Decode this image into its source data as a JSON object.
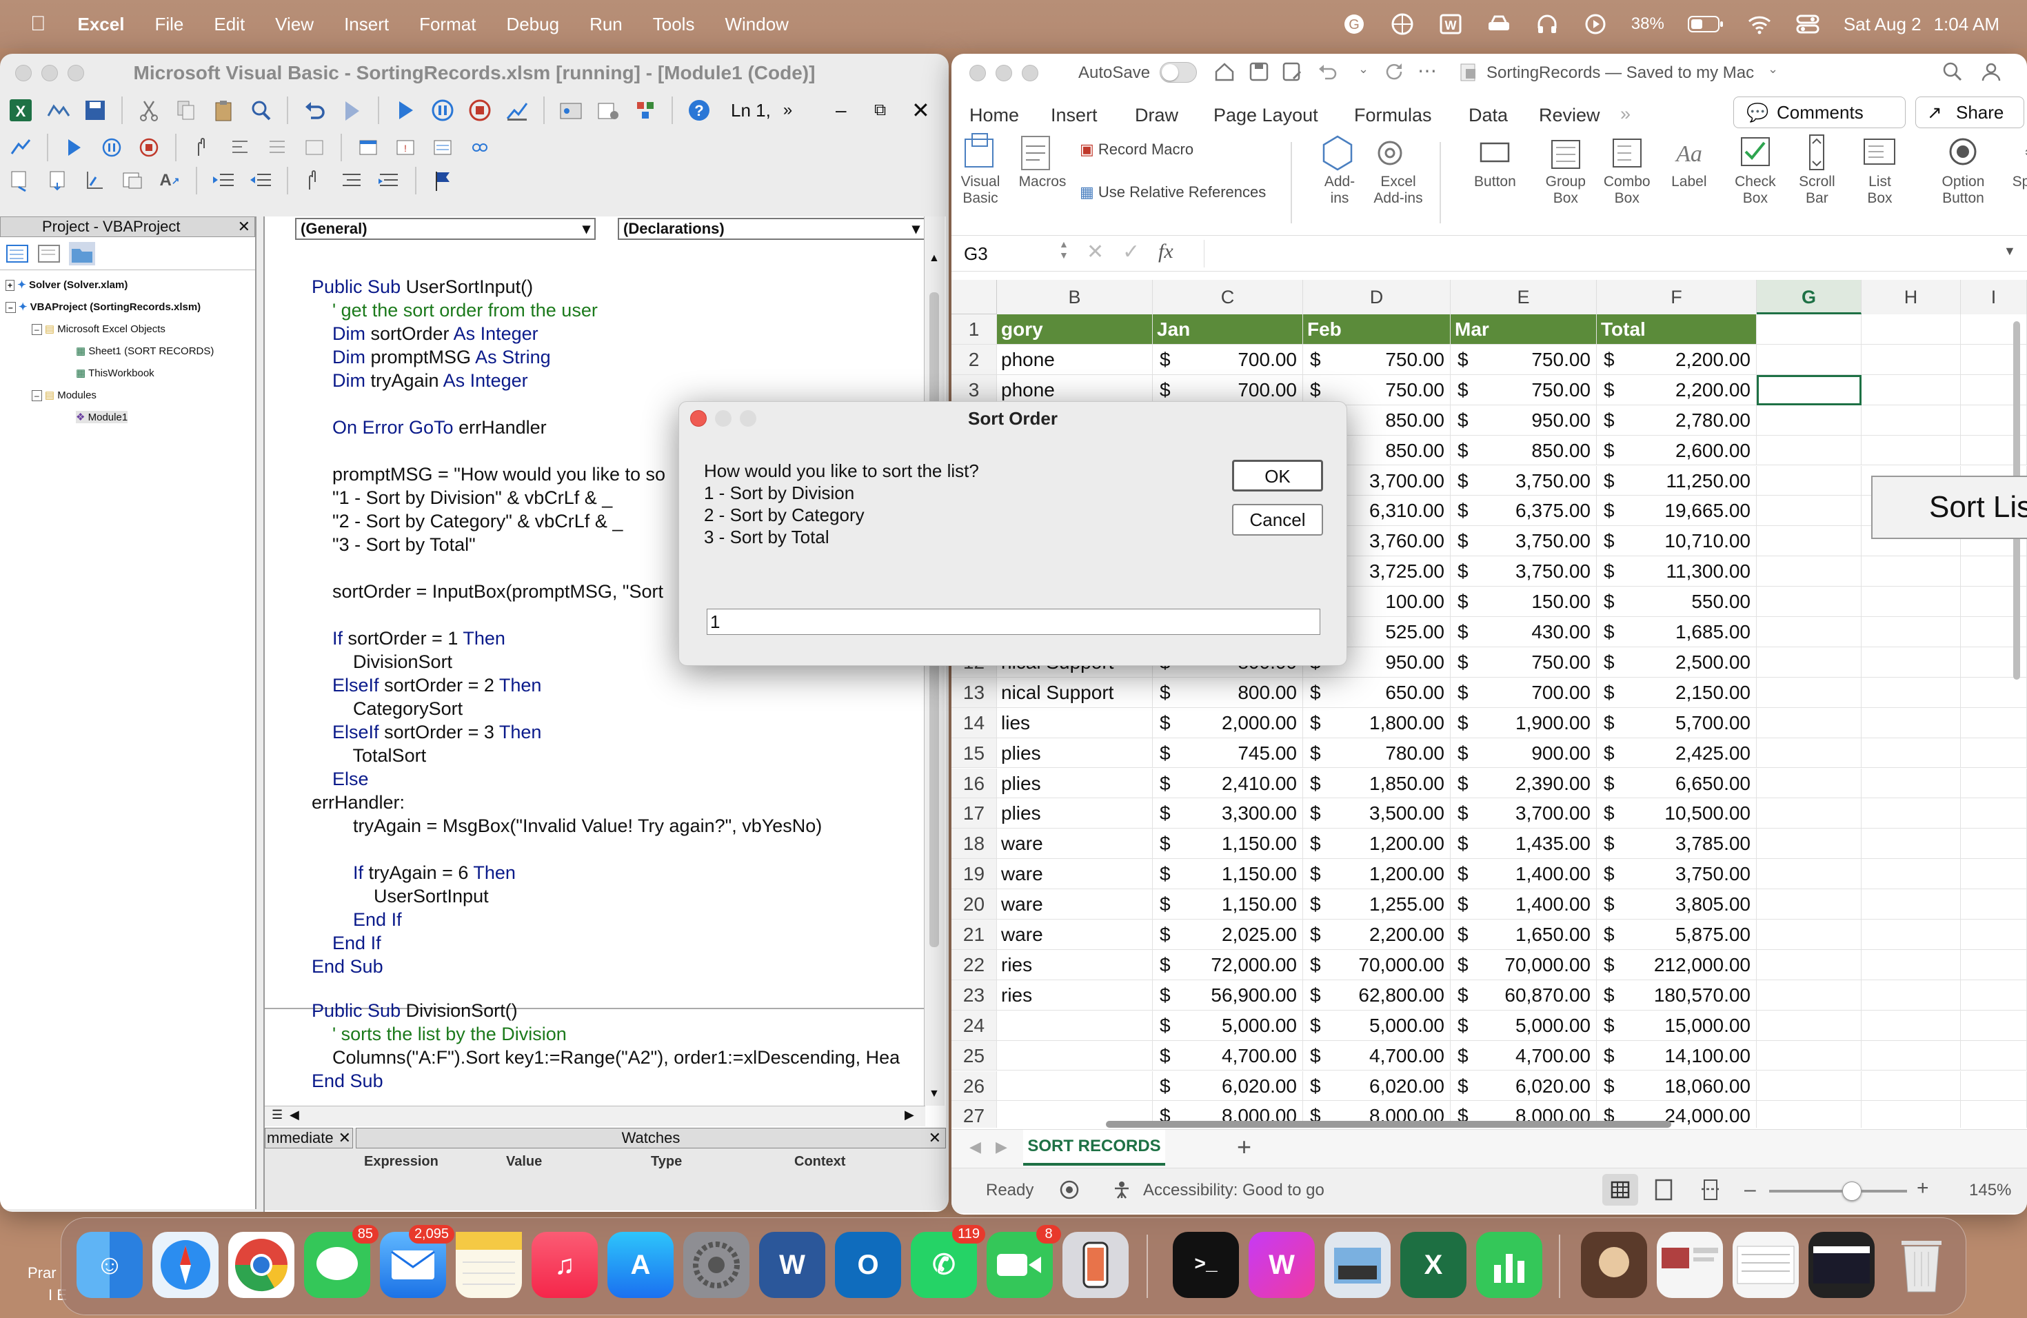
{
  "menubar": {
    "app": "Excel",
    "items": [
      "File",
      "Edit",
      "View",
      "Insert",
      "Format",
      "Debug",
      "Run",
      "Tools",
      "Window"
    ],
    "battery": "38%",
    "date": "Sat Aug 2",
    "time": "1:04 AM"
  },
  "vbe": {
    "title": "Microsoft Visual Basic - SortingRecords.xlsm [running] - [Module1 (Code)]",
    "position": "Ln 1,",
    "project_title": "Project - VBAProject",
    "tree": [
      "Solver (Solver.xlam)",
      "VBAProject (SortingRecords.xlsm)",
      "Microsoft Excel Objects",
      "Sheet1 (SORT RECORDS)",
      "ThisWorkbook",
      "Modules",
      "Module1"
    ],
    "combo_left": "(General)",
    "combo_right": "(Declarations)",
    "immediate": "mmediate",
    "watches": "Watches",
    "watch_cols": [
      "Expression",
      "Value",
      "Type",
      "Context"
    ],
    "code1": [
      "Public Sub UserSortInput()",
      "    ' get the sort order from the user",
      "    Dim sortOrder As Integer",
      "    Dim promptMSG As String",
      "    Dim tryAgain As Integer",
      "",
      "    On Error GoTo errHandler",
      "",
      "    promptMSG = \"How would you like to so",
      "    \"1 - Sort by Division\" & vbCrLf & _",
      "    \"2 - Sort by Category\" & vbCrLf & _",
      "    \"3 - Sort by Total\"",
      "",
      "    sortOrder = InputBox(promptMSG, \"Sort",
      "",
      "    If sortOrder = 1 Then",
      "        DivisionSort",
      "    ElseIf sortOrder = 2 Then",
      "        CategorySort",
      "    ElseIf sortOrder = 3 Then",
      "        TotalSort",
      "    Else",
      "errHandler:",
      "        tryAgain = MsgBox(\"Invalid Value! Try again?\", vbYesNo)",
      "",
      "        If tryAgain = 6 Then",
      "            UserSortInput",
      "        End If",
      "    End If",
      "End Sub"
    ],
    "code2": [
      "Public Sub DivisionSort()",
      "    ' sorts the list by the Division",
      "    Columns(\"A:F\").Sort key1:=Range(\"A2\"), order1:=xlDescending, Hea",
      "End Sub"
    ]
  },
  "dialog": {
    "title": "Sort Order",
    "lines": [
      "How would you like to sort the list?",
      "1 - Sort by Division",
      "2 - Sort by Category",
      "3 - Sort by Total"
    ],
    "ok": "OK",
    "cancel": "Cancel",
    "input_value": "1"
  },
  "excel": {
    "autosave": "AutoSave",
    "doc_title": "SortingRecords — Saved to my Mac",
    "tabs": [
      "Home",
      "Insert",
      "Draw",
      "Page Layout",
      "Formulas",
      "Data",
      "Review"
    ],
    "comments": "Comments",
    "share": "Share",
    "ribbon": {
      "visual_basic": "Visual Basic",
      "macros": "Macros",
      "record_macro": "Record Macro",
      "relative_refs": "Use Relative References",
      "addins": "Add-ins",
      "excel_addins": "Excel Add-ins",
      "controls": [
        "Button",
        "Group Box",
        "Combo Box",
        "Label",
        "Check Box",
        "Scroll Bar",
        "List Box",
        "Option Button",
        "Spinner"
      ]
    },
    "name_box": "G3",
    "columns": [
      "B",
      "C",
      "D",
      "E",
      "F",
      "G",
      "H",
      "I"
    ],
    "header_row": [
      "gory",
      "Jan",
      "Feb",
      "Mar",
      "Total"
    ],
    "rows": [
      {
        "n": "2",
        "b": "phone",
        "c": "700.00",
        "d": "750.00",
        "e": "750.00",
        "f": "2,200.00"
      },
      {
        "n": "3",
        "b": "phone",
        "c": "700.00",
        "d": "750.00",
        "e": "750.00",
        "f": "2,200.00"
      },
      {
        "n": "4",
        "b": "",
        "c": "",
        "d": "850.00",
        "e": "950.00",
        "f": "2,780.00"
      },
      {
        "n": "5",
        "b": "",
        "c": "",
        "d": "850.00",
        "e": "850.00",
        "f": "2,600.00"
      },
      {
        "n": "6",
        "b": "",
        "c": "",
        "d": "3,700.00",
        "e": "3,750.00",
        "f": "11,250.00"
      },
      {
        "n": "7",
        "b": "",
        "c": "",
        "d": "6,310.00",
        "e": "6,375.00",
        "f": "19,665.00"
      },
      {
        "n": "8",
        "b": "",
        "c": "",
        "d": "3,760.00",
        "e": "3,750.00",
        "f": "10,710.00"
      },
      {
        "n": "9",
        "b": "",
        "c": "",
        "d": "3,725.00",
        "e": "3,750.00",
        "f": "11,300.00"
      },
      {
        "n": "10",
        "b": "",
        "c": "",
        "d": "100.00",
        "e": "150.00",
        "f": "550.00"
      },
      {
        "n": "11",
        "b": "",
        "c": "",
        "d": "525.00",
        "e": "430.00",
        "f": "1,685.00"
      },
      {
        "n": "12",
        "b": "nical Support",
        "c": "800.00",
        "d": "950.00",
        "e": "750.00",
        "f": "2,500.00"
      },
      {
        "n": "13",
        "b": "nical Support",
        "c": "800.00",
        "d": "650.00",
        "e": "700.00",
        "f": "2,150.00"
      },
      {
        "n": "14",
        "b": "lies",
        "c": "2,000.00",
        "d": "1,800.00",
        "e": "1,900.00",
        "f": "5,700.00"
      },
      {
        "n": "15",
        "b": "plies",
        "c": "745.00",
        "d": "780.00",
        "e": "900.00",
        "f": "2,425.00"
      },
      {
        "n": "16",
        "b": "plies",
        "c": "2,410.00",
        "d": "1,850.00",
        "e": "2,390.00",
        "f": "6,650.00"
      },
      {
        "n": "17",
        "b": "plies",
        "c": "3,300.00",
        "d": "3,500.00",
        "e": "3,700.00",
        "f": "10,500.00"
      },
      {
        "n": "18",
        "b": "ware",
        "c": "1,150.00",
        "d": "1,200.00",
        "e": "1,435.00",
        "f": "3,785.00"
      },
      {
        "n": "19",
        "b": "ware",
        "c": "1,150.00",
        "d": "1,200.00",
        "e": "1,400.00",
        "f": "3,750.00"
      },
      {
        "n": "20",
        "b": "ware",
        "c": "1,150.00",
        "d": "1,255.00",
        "e": "1,400.00",
        "f": "3,805.00"
      },
      {
        "n": "21",
        "b": "ware",
        "c": "2,025.00",
        "d": "2,200.00",
        "e": "1,650.00",
        "f": "5,875.00"
      },
      {
        "n": "22",
        "b": "ries",
        "c": "72,000.00",
        "d": "70,000.00",
        "e": "70,000.00",
        "f": "212,000.00"
      },
      {
        "n": "23",
        "b": "ries",
        "c": "56,900.00",
        "d": "62,800.00",
        "e": "60,870.00",
        "f": "180,570.00"
      },
      {
        "n": "24",
        "b": "",
        "c": "5,000.00",
        "d": "5,000.00",
        "e": "5,000.00",
        "f": "15,000.00"
      },
      {
        "n": "25",
        "b": "",
        "c": "4,700.00",
        "d": "4,700.00",
        "e": "4,700.00",
        "f": "14,100.00"
      },
      {
        "n": "26",
        "b": "",
        "c": "6,020.00",
        "d": "6,020.00",
        "e": "6,020.00",
        "f": "18,060.00"
      },
      {
        "n": "27",
        "b": "",
        "c": "8,000.00",
        "d": "8,000.00",
        "e": "8,000.00",
        "f": "24,000.00"
      }
    ],
    "sort_button": "Sort Lis",
    "sheet_tab": "SORT RECORDS",
    "status": "Ready",
    "accessibility": "Accessibility: Good to go",
    "zoom": "145%",
    "header_color": "#5b8b3a"
  },
  "dock": {
    "badges": {
      "messages": "85",
      "mail": "2,095",
      "whatsapp": "119",
      "facetime": "8"
    },
    "left_text": "Prar",
    "left_text2": "I E"
  }
}
